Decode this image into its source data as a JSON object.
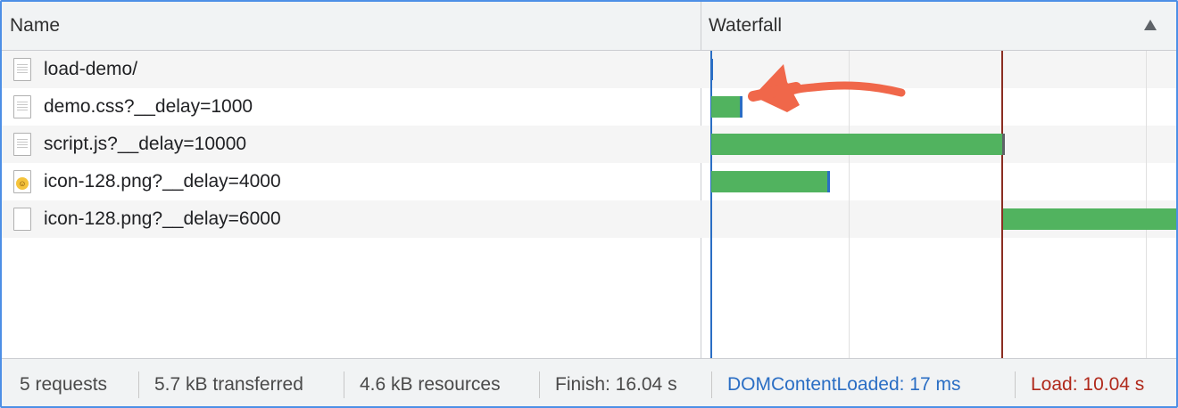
{
  "header": {
    "name_label": "Name",
    "waterfall_label": "Waterfall"
  },
  "requests": [
    {
      "name": "load-demo/",
      "icon": "document-icon"
    },
    {
      "name": "demo.css?__delay=1000",
      "icon": "document-icon"
    },
    {
      "name": "script.js?__delay=10000",
      "icon": "document-icon"
    },
    {
      "name": "icon-128.png?__delay=4000",
      "icon": "image-emoji-icon"
    },
    {
      "name": "icon-128.png?__delay=6000",
      "icon": "blank-file-icon"
    }
  ],
  "footer": {
    "requests": "5 requests",
    "transferred": "5.7 kB transferred",
    "resources": "4.6 kB resources",
    "finish": "Finish: 16.04 s",
    "dom_content_loaded": "DOMContentLoaded: 17 ms",
    "load": "Load: 10.04 s"
  },
  "colors": {
    "bar": "#51b35f",
    "dcl_line": "#2a6ec4",
    "load_line": "#8b2e22",
    "annotation_arrow": "#f0674a",
    "focus_border": "#4d8fe6"
  }
}
